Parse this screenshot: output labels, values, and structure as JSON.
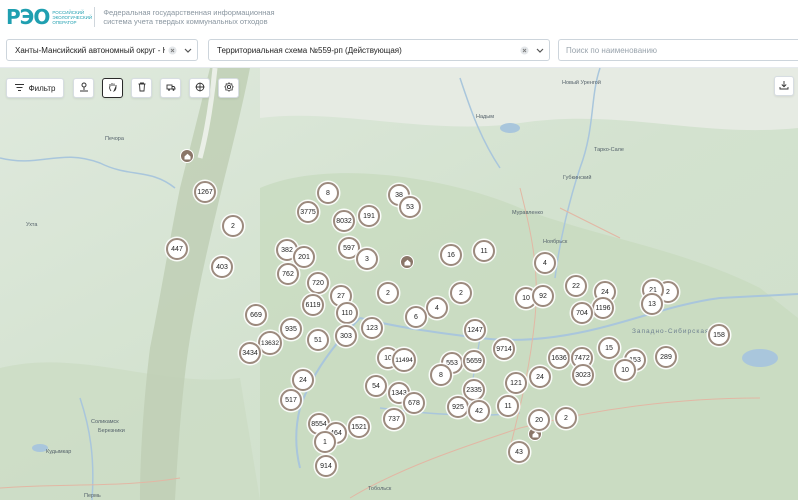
{
  "header": {
    "logo_text": "РЭО",
    "logo_caption": "Российский экологический оператор",
    "title_line1": "Федеральная государственная информационная",
    "title_line2": "система учета твердых коммунальных отходов"
  },
  "filters": {
    "region": "Ханты-Мансийский автономный округ - Югра",
    "scheme": "Территориальная схема №559-рп (Действующая)",
    "search_placeholder": "Поиск по наименованию"
  },
  "toolbar": {
    "filter_label": "Фильтр",
    "tools": [
      "person-pin-icon",
      "hand-icon",
      "trash-icon",
      "truck-icon",
      "crosshair-icon",
      "settings-icon"
    ],
    "download": "download-icon"
  },
  "map_labels": [
    "Новый Уренгой",
    "Надым",
    "Тарко-Сале",
    "Губкинский",
    "Муравленко",
    "Ноябрьск",
    "Печора",
    "Ухта",
    "Соликамск",
    "Кудымкар",
    "Березники",
    "Тобольск",
    "Пермь",
    "Западно-Сибирская"
  ],
  "clusters": [
    "8",
    "38",
    "1267",
    "3775",
    "53",
    "191",
    "8032",
    "2",
    "382",
    "597",
    "447",
    "403",
    "201",
    "3",
    "16",
    "11",
    "4",
    "762",
    "720",
    "22",
    "24",
    "27",
    "2",
    "2",
    "10",
    "92",
    "2",
    "21",
    "6119",
    "4",
    "1196",
    "669",
    "110",
    "13",
    "704",
    "935",
    "6",
    "1247",
    "13632",
    "123",
    "158",
    "303",
    "51",
    "9714",
    "3434",
    "10",
    "11494",
    "553",
    "5659",
    "1636",
    "7472",
    "15",
    "153",
    "289",
    "8",
    "3023",
    "10",
    "24",
    "54",
    "121",
    "24",
    "1343",
    "2335",
    "517",
    "678",
    "925",
    "42",
    "11",
    "737",
    "8554",
    "1521",
    "20",
    "2",
    "464",
    "1",
    "43",
    "914"
  ]
}
